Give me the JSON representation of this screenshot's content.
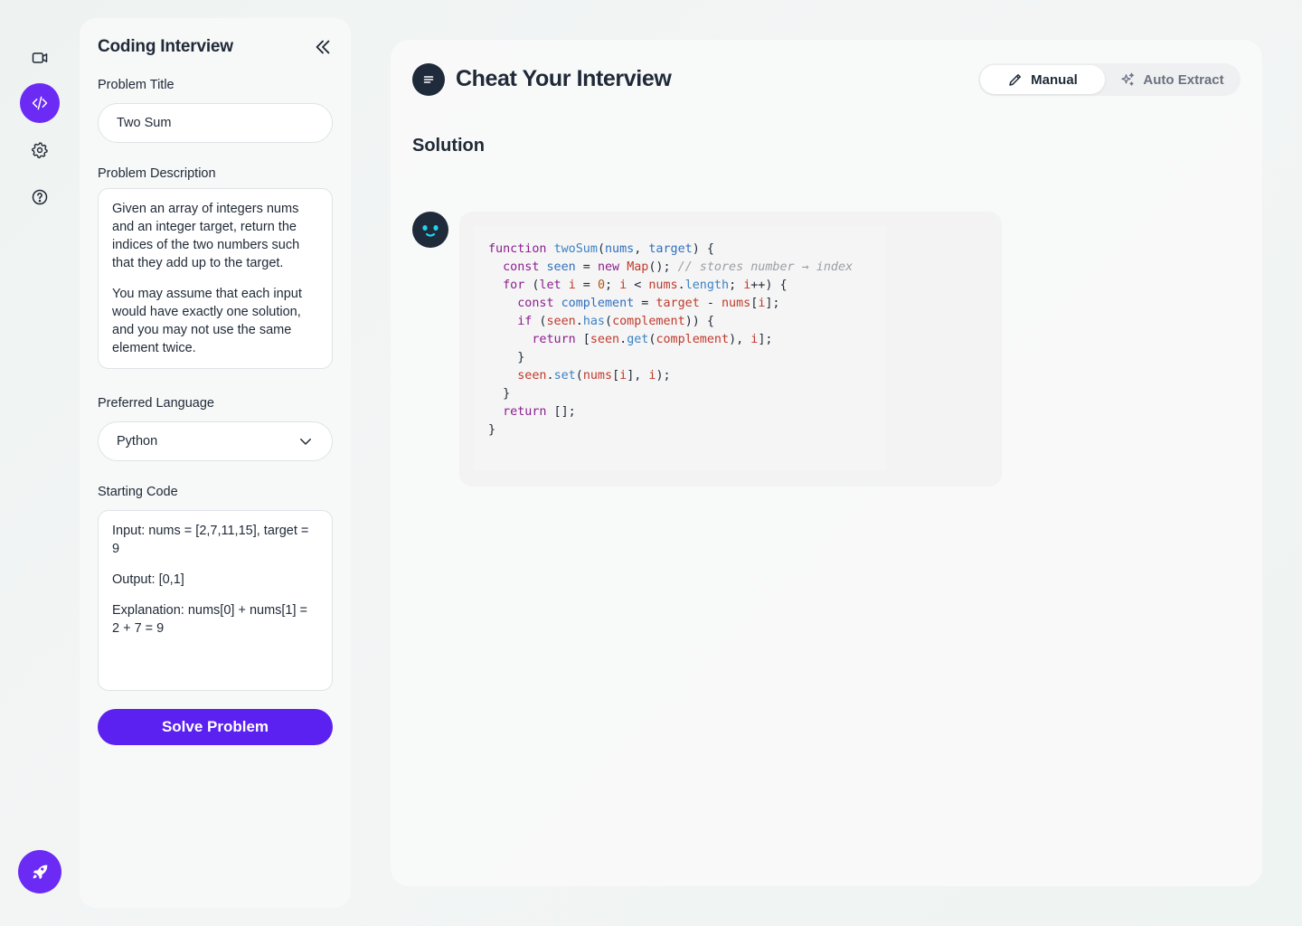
{
  "rail": {
    "items": [
      {
        "name": "video-icon",
        "active": false
      },
      {
        "name": "code-icon",
        "active": true
      },
      {
        "name": "settings-icon",
        "active": false
      },
      {
        "name": "help-icon",
        "active": false
      }
    ],
    "launch": "rocket-icon",
    "accent": "#6b2bf5"
  },
  "panel": {
    "title": "Coding Interview",
    "problem_title_label": "Problem Title",
    "problem_title_value": "Two Sum",
    "description_label": "Problem Description",
    "description_p1": "Given an array of integers nums and an integer target, return the indices of the two numbers such that they add up to the target.",
    "description_p2": "You may assume that each input would have exactly one solution, and you may not use the same element twice.",
    "language_label": "Preferred Language",
    "language_value": "Python",
    "starting_code_label": "Starting Code",
    "starting_code_p1": "Input: nums = [2,7,11,15], target = 9",
    "starting_code_p2": "Output: [0,1]",
    "starting_code_p3": "Explanation: nums[0] + nums[1] = 2 + 7 = 9",
    "solve_label": "Solve Problem",
    "solve_color": "#5b21f0"
  },
  "main": {
    "title": "Cheat Your Interview",
    "modes": {
      "manual": "Manual",
      "auto": "Auto Extract",
      "selected": "Manual"
    },
    "section_title": "Solution",
    "code_lines": [
      "function twoSum(nums, target) {",
      "  const seen = new Map(); // stores number → index",
      "  for (let i = 0; i < nums.length; i++) {",
      "    const complement = target - nums[i];",
      "    if (seen.has(complement)) {",
      "      return [seen.get(complement), i];",
      "    }",
      "    seen.set(nums[i], i);",
      "  }",
      "  return [];",
      "}"
    ]
  }
}
